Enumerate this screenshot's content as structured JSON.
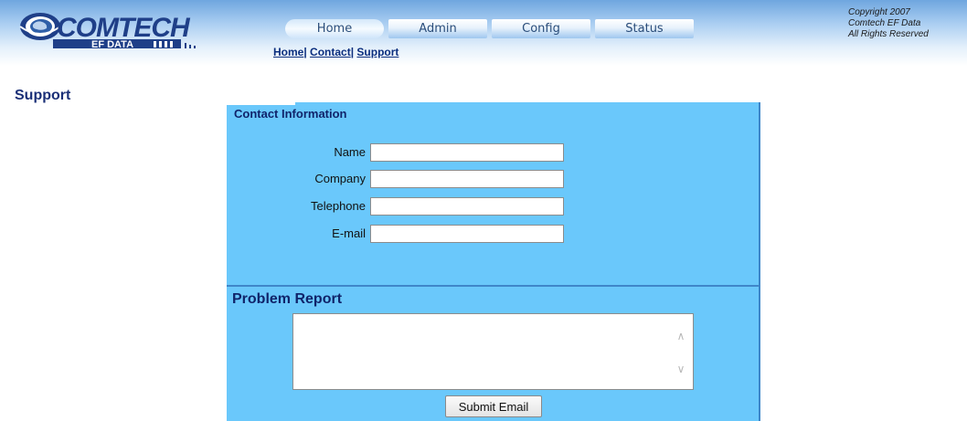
{
  "brand": {
    "name": "COMTECH",
    "sub": "EF DATA"
  },
  "nav": {
    "tabs": [
      {
        "label": "Home"
      },
      {
        "label": "Admin"
      },
      {
        "label": "Config"
      },
      {
        "label": "Status"
      }
    ],
    "active_tab": "Home",
    "sublinks": [
      {
        "label": "Home"
      },
      {
        "label": "Contact"
      },
      {
        "label": "Support"
      }
    ],
    "separator": "|"
  },
  "copyright": {
    "line1": "Copyright 2007",
    "line2": "Comtech EF Data",
    "line3": "All Rights Reserved"
  },
  "page": {
    "title": "Support"
  },
  "contact": {
    "title": "Contact Information",
    "fields": [
      {
        "label": "Name",
        "value": ""
      },
      {
        "label": "Company",
        "value": ""
      },
      {
        "label": "Telephone",
        "value": ""
      },
      {
        "label": "E-mail",
        "value": ""
      }
    ]
  },
  "problem": {
    "title": "Problem Report",
    "value": ""
  },
  "submit_label": "Submit Email",
  "colors": {
    "panel": "#6ac8fb",
    "panel_border": "#3f86c9",
    "title_text": "#10246a",
    "link_text": "#0b2e7e"
  }
}
